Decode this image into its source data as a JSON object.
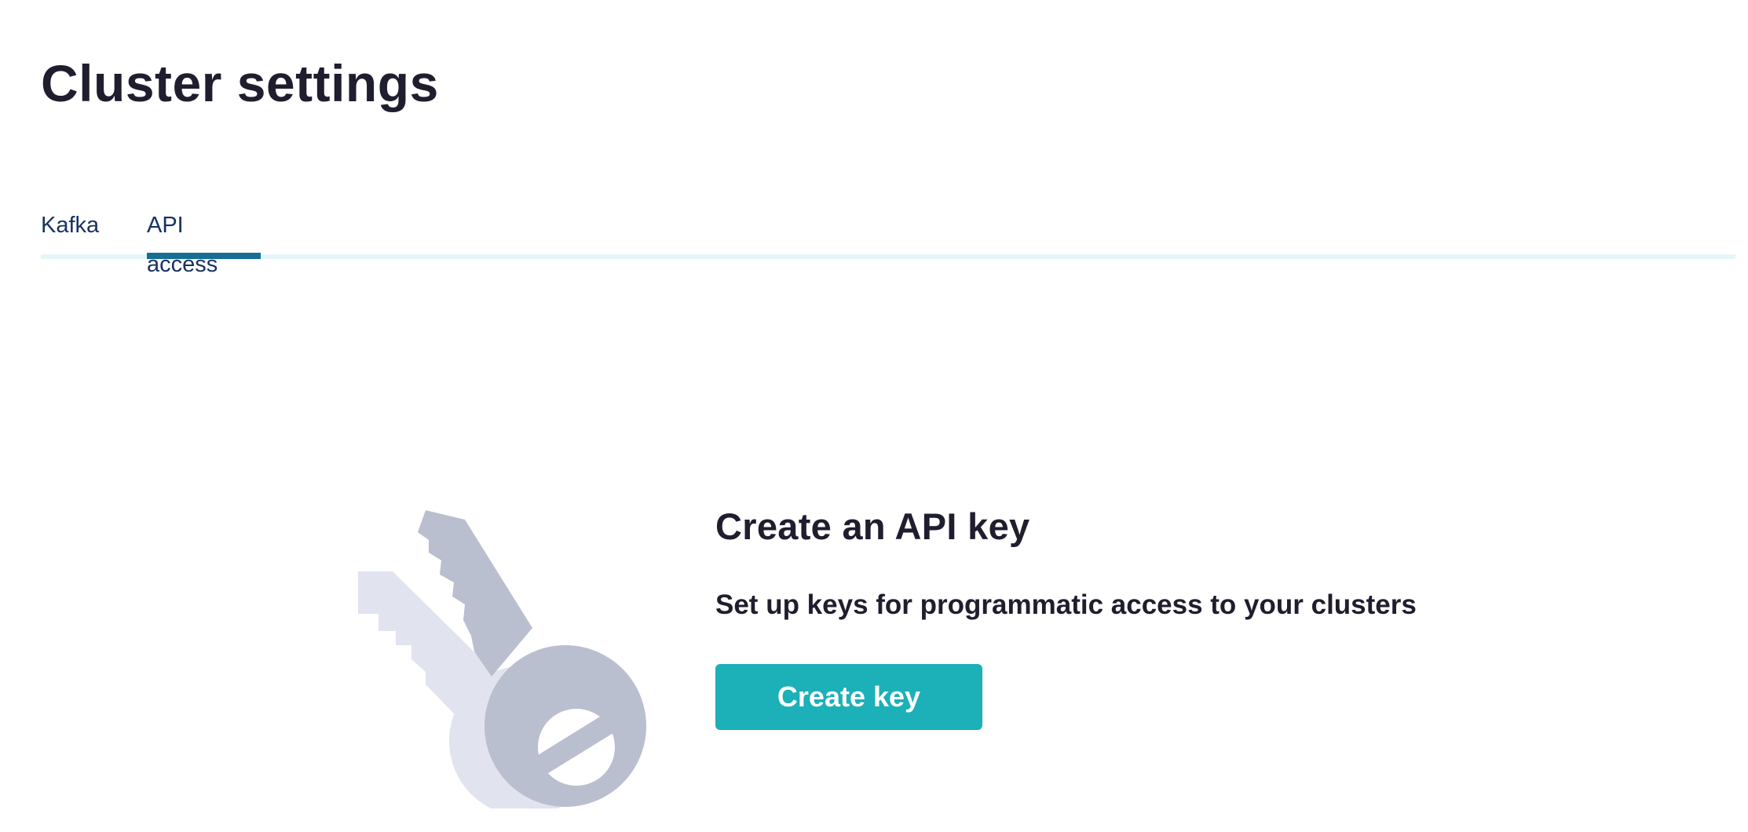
{
  "page": {
    "title": "Cluster settings"
  },
  "tabs": {
    "items": [
      {
        "label": "Kafka",
        "active": false
      },
      {
        "label": "API access",
        "active": true
      }
    ],
    "active_color": "#166e95",
    "text_color": "#173361"
  },
  "empty_state": {
    "illustration": "keys-icon",
    "title": "Create an API key",
    "subtitle": "Set up keys for programmatic access to your clusters",
    "button_label": "Create key",
    "button_color": "#1cb0b8"
  }
}
